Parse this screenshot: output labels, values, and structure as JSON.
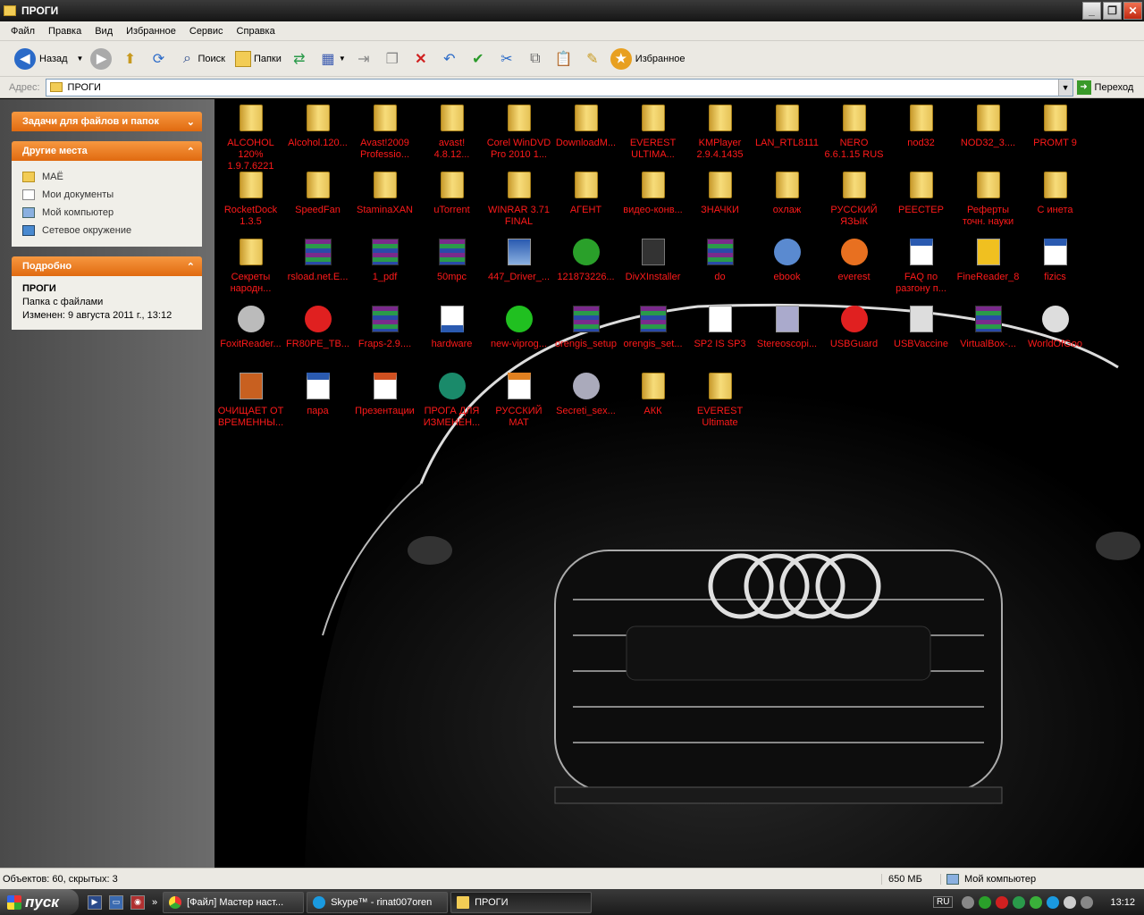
{
  "window": {
    "title": "ПРОГИ",
    "min": "_",
    "max": "❐",
    "close": "✕"
  },
  "menu": [
    "Файл",
    "Правка",
    "Вид",
    "Избранное",
    "Сервис",
    "Справка"
  ],
  "toolbar": {
    "back": "Назад",
    "search": "Поиск",
    "folders": "Папки",
    "favorites": "Избранное"
  },
  "address": {
    "label": "Адрес:",
    "value": "ПРОГИ",
    "go": "Переход"
  },
  "leftpane": {
    "tasks_title": "Задачи для файлов и папок",
    "places_title": "Другие места",
    "places": [
      "МАЁ",
      "Мои документы",
      "Мой компьютер",
      "Сетевое окружение"
    ],
    "details_title": "Подробно",
    "details_name": "ПРОГИ",
    "details_type": "Папка с файлами",
    "details_modified": "Изменен: 9 августа 2011 г., 13:12"
  },
  "files": [
    {
      "l1": "ALCOHOL",
      "l2": "120%",
      "l3": "1.9.7.6221",
      "icon": "folder"
    },
    {
      "l1": "Alcohol.120...",
      "l2": "",
      "l3": "",
      "icon": "folder"
    },
    {
      "l1": "Avast!2009",
      "l2": "Professio...",
      "l3": "",
      "icon": "folder"
    },
    {
      "l1": "avast!",
      "l2": "4.8.12...",
      "l3": "",
      "icon": "folder"
    },
    {
      "l1": "Corel WinDVD",
      "l2": "Pro 2010 1...",
      "l3": "",
      "icon": "folder"
    },
    {
      "l1": "DownloadM...",
      "l2": "",
      "l3": "",
      "icon": "folder"
    },
    {
      "l1": "EVEREST",
      "l2": "ULTIMA...",
      "l3": "",
      "icon": "folder"
    },
    {
      "l1": "KMPlayer",
      "l2": "2.9.4.1435",
      "l3": "",
      "icon": "folder"
    },
    {
      "l1": "LAN_RTL8111",
      "l2": "",
      "l3": "",
      "icon": "folder"
    },
    {
      "l1": "NERO",
      "l2": "6.6.1.15 RUS",
      "l3": "",
      "icon": "folder"
    },
    {
      "l1": "nod32",
      "l2": "",
      "l3": "",
      "icon": "folder"
    },
    {
      "l1": "NOD32_3....",
      "l2": "",
      "l3": "",
      "icon": "folder"
    },
    {
      "l1": "PROMT 9",
      "l2": "",
      "l3": "",
      "icon": "folder"
    },
    {
      "l1": "RocketDock",
      "l2": "1.3.5",
      "l3": "",
      "icon": "folder"
    },
    {
      "l1": "SpeedFan",
      "l2": "",
      "l3": "",
      "icon": "folder"
    },
    {
      "l1": "StaminaXAN",
      "l2": "",
      "l3": "",
      "icon": "folder"
    },
    {
      "l1": "uTorrent",
      "l2": "",
      "l3": "",
      "icon": "folder"
    },
    {
      "l1": "WINRAR 3.71",
      "l2": "FINAL",
      "l3": "",
      "icon": "folder"
    },
    {
      "l1": "АГЕНТ",
      "l2": "",
      "l3": "",
      "icon": "folder"
    },
    {
      "l1": "видео-конв...",
      "l2": "",
      "l3": "",
      "icon": "folder"
    },
    {
      "l1": "ЗНАЧКИ",
      "l2": "",
      "l3": "",
      "icon": "folder"
    },
    {
      "l1": "охлаж",
      "l2": "",
      "l3": "",
      "icon": "folder"
    },
    {
      "l1": "РУССКИЙ",
      "l2": "ЯЗЫК",
      "l3": "",
      "icon": "folder"
    },
    {
      "l1": "РЕЕСТЕР",
      "l2": "",
      "l3": "",
      "icon": "folder"
    },
    {
      "l1": "Реферты",
      "l2": "точн. науки",
      "l3": "",
      "icon": "folder"
    },
    {
      "l1": "С инета",
      "l2": "",
      "l3": "",
      "icon": "folder"
    },
    {
      "l1": "Секреты",
      "l2": "народн...",
      "l3": "",
      "icon": "folder"
    },
    {
      "l1": "rsload.net.E...",
      "l2": "",
      "l3": "",
      "icon": "rar"
    },
    {
      "l1": "1_pdf",
      "l2": "",
      "l3": "",
      "icon": "rar"
    },
    {
      "l1": "50mpc",
      "l2": "",
      "l3": "",
      "icon": "rar"
    },
    {
      "l1": "447_Driver_...",
      "l2": "",
      "l3": "",
      "icon": "exe"
    },
    {
      "l1": "121873226...",
      "l2": "",
      "l3": "",
      "icon": "icq"
    },
    {
      "l1": "DivXInstaller",
      "l2": "",
      "l3": "",
      "icon": "box"
    },
    {
      "l1": "do",
      "l2": "",
      "l3": "",
      "icon": "rar"
    },
    {
      "l1": "ebook",
      "l2": "",
      "l3": "",
      "icon": "ebook"
    },
    {
      "l1": "everest",
      "l2": "",
      "l3": "",
      "icon": "info"
    },
    {
      "l1": "FAQ по",
      "l2": "разгону п...",
      "l3": "",
      "icon": "word"
    },
    {
      "l1": "FineReader_8",
      "l2": "",
      "l3": "",
      "icon": "finereader"
    },
    {
      "l1": "fizics",
      "l2": "",
      "l3": "",
      "icon": "word"
    },
    {
      "l1": "FoxitReader...",
      "l2": "",
      "l3": "",
      "icon": "cd"
    },
    {
      "l1": "FR80PE_TB...",
      "l2": "",
      "l3": "",
      "icon": "fr"
    },
    {
      "l1": "Fraps-2.9....",
      "l2": "",
      "l3": "",
      "icon": "rar"
    },
    {
      "l1": "hardware",
      "l2": "",
      "l3": "",
      "icon": "help"
    },
    {
      "l1": "new-viprog...",
      "l2": "",
      "l3": "",
      "icon": "green"
    },
    {
      "l1": "orengis_setup",
      "l2": "",
      "l3": "",
      "icon": "rar"
    },
    {
      "l1": "orengis_set...",
      "l2": "",
      "l3": "",
      "icon": "rar"
    },
    {
      "l1": "SP2 IS SP3",
      "l2": "",
      "l3": "",
      "icon": "doc"
    },
    {
      "l1": "Stereoscopi...",
      "l2": "",
      "l3": "",
      "icon": "setup"
    },
    {
      "l1": "USBGuard",
      "l2": "",
      "l3": "",
      "icon": "usb"
    },
    {
      "l1": "USBVaccine",
      "l2": "",
      "l3": "",
      "icon": "syringe"
    },
    {
      "l1": "VirtualBox-...",
      "l2": "",
      "l3": "",
      "icon": "rar"
    },
    {
      "l1": "WorldOfGoo",
      "l2": "",
      "l3": "",
      "icon": "goo"
    },
    {
      "l1": "ОЧИЩАЕТ ОТ",
      "l2": "ВРЕМЕННЫ...",
      "l3": "",
      "icon": "crab"
    },
    {
      "l1": "пара",
      "l2": "",
      "l3": "",
      "icon": "word"
    },
    {
      "l1": "Презентации",
      "l2": "",
      "l3": "",
      "icon": "ppt"
    },
    {
      "l1": "ПРОГА ДЛЯ",
      "l2": "ИЗМЕНЕН...",
      "l3": "",
      "icon": "globe"
    },
    {
      "l1": "РУССКИЙ",
      "l2": "МАТ",
      "l3": "",
      "icon": "pdf"
    },
    {
      "l1": "Secreti_sex...",
      "l2": "",
      "l3": "",
      "icon": "disc"
    },
    {
      "l1": "АКК",
      "l2": "",
      "l3": "",
      "icon": "folder"
    },
    {
      "l1": "EVEREST",
      "l2": "Ultimate",
      "l3": "",
      "icon": "folder"
    }
  ],
  "status": {
    "objects": "Объектов: 60, скрытых: 3",
    "size": "650 МБ",
    "location": "Мой компьютер"
  },
  "taskbar": {
    "start": "пуск",
    "tasks": [
      "[Файл] Мастер наст...",
      "Skype™ - rinat007oren",
      "ПРОГИ"
    ],
    "lang": "RU",
    "clock": "13:12"
  }
}
